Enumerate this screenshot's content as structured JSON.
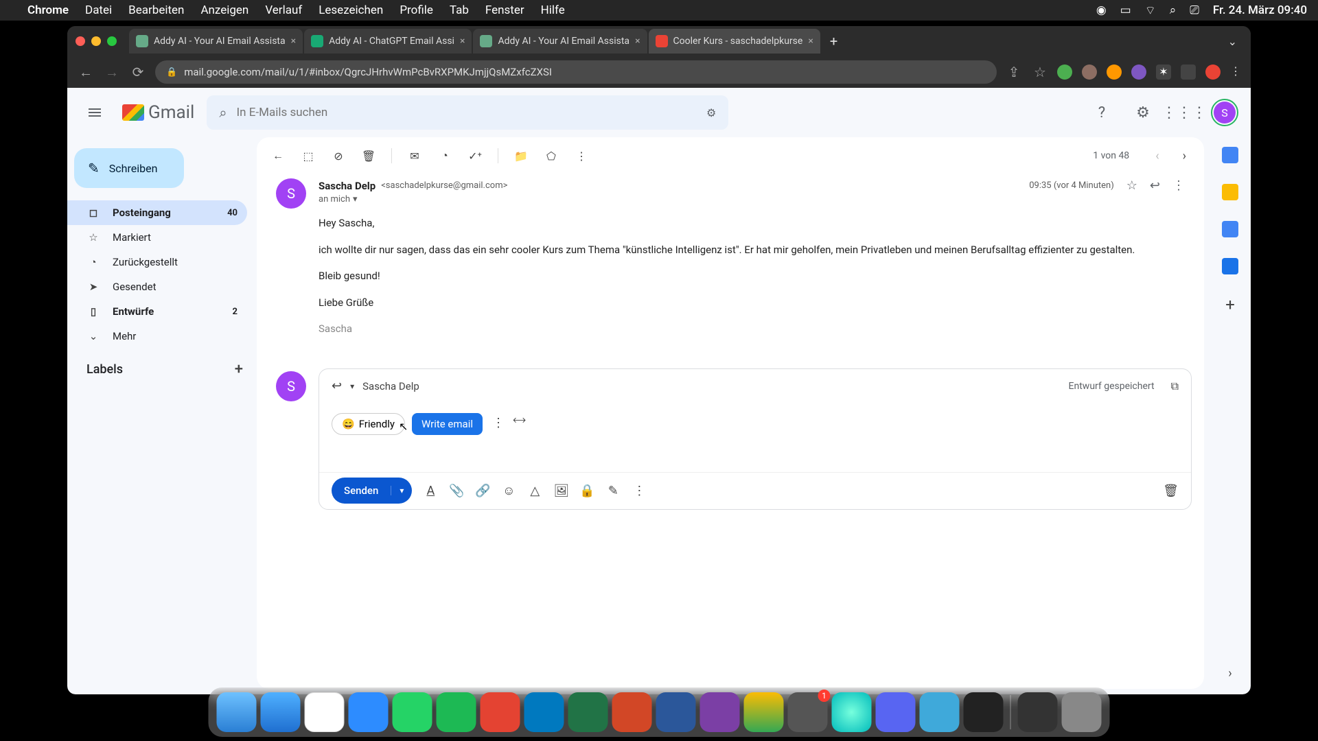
{
  "menubar": {
    "app": "Chrome",
    "items": [
      "Datei",
      "Bearbeiten",
      "Anzeigen",
      "Verlauf",
      "Lesezeichen",
      "Profile",
      "Tab",
      "Fenster",
      "Hilfe"
    ],
    "clock": "Fr. 24. März  09:40"
  },
  "tabs": {
    "items": [
      {
        "title": "Addy AI - Your AI Email Assista"
      },
      {
        "title": "Addy AI - ChatGPT Email Assi"
      },
      {
        "title": "Addy AI - Your AI Email Assista"
      },
      {
        "title": "Cooler Kurs - saschadelpkurse"
      }
    ]
  },
  "url": "mail.google.com/mail/u/1/#inbox/QgrcJHrhvWmPcBvRXPMKJmjjQsMZxfcZXSI",
  "gmail": {
    "logo_text": "Gmail",
    "search_placeholder": "In E-Mails suchen",
    "compose": "Schreiben",
    "nav": [
      {
        "label": "Posteingang",
        "count": "40",
        "active": true,
        "icon": "inbox"
      },
      {
        "label": "Markiert",
        "count": "",
        "active": false,
        "icon": "star"
      },
      {
        "label": "Zurückgestellt",
        "count": "",
        "active": false,
        "icon": "clock"
      },
      {
        "label": "Gesendet",
        "count": "",
        "active": false,
        "icon": "send"
      },
      {
        "label": "Entwürfe",
        "count": "2",
        "active": false,
        "icon": "draft"
      },
      {
        "label": "Mehr",
        "count": "",
        "active": false,
        "icon": "more"
      }
    ],
    "labels_header": "Labels",
    "page_counter": "1 von 48"
  },
  "message": {
    "sender_name": "Sascha Delp",
    "sender_email": "<saschadelpkurse@gmail.com>",
    "recipient": "an mich",
    "timestamp": "09:35 (vor 4 Minuten)",
    "avatar_letter": "S",
    "body": {
      "p1": "Hey Sascha,",
      "p2": "ich wollte dir nur sagen, dass das ein sehr cooler Kurs zum Thema \"künstliche Intelligenz ist\". Er hat mir geholfen, mein Privatleben und meinen Berufsalltag effizienter zu gestalten.",
      "p3": "Bleib gesund!",
      "p4": "Liebe Grüße",
      "sig": "Sascha"
    }
  },
  "compose": {
    "reply_to": "Sascha Delp",
    "draft_status": "Entwurf gespeichert",
    "addy_tone": "Friendly",
    "addy_tone_emoji": "😄",
    "addy_write": "Write email",
    "send": "Senden",
    "avatar_letter": "S"
  }
}
